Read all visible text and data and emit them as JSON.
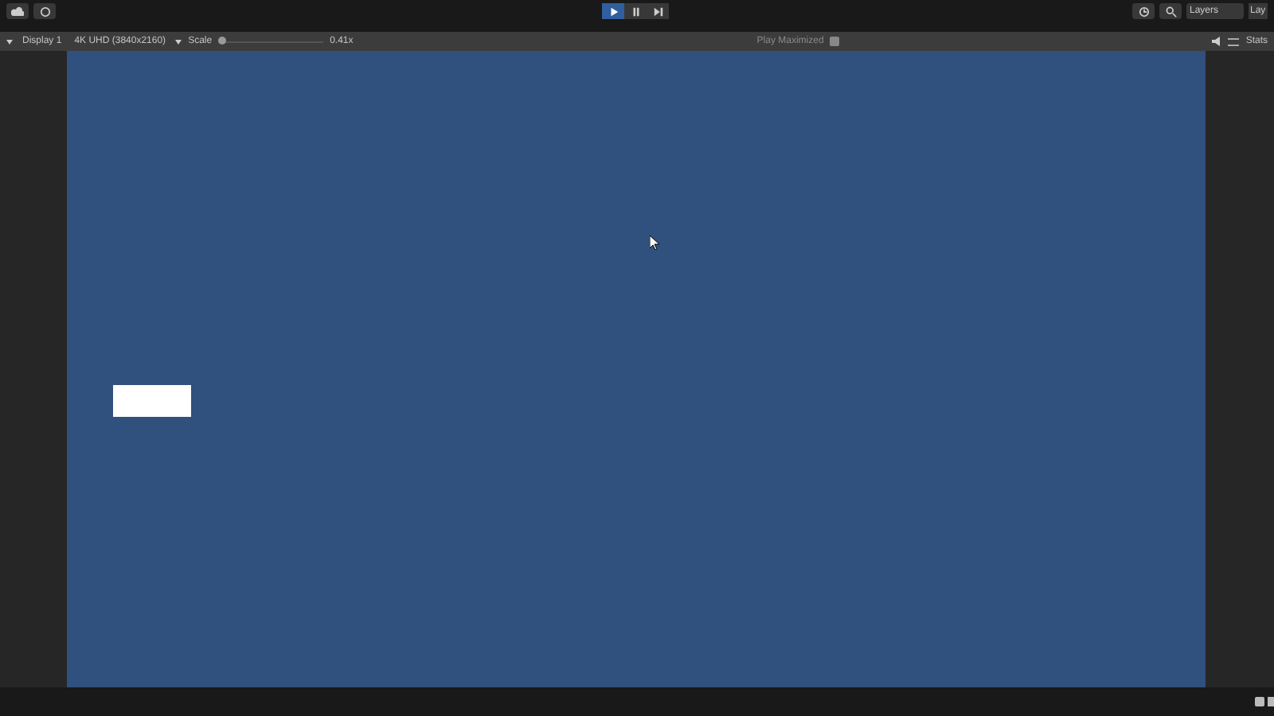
{
  "toolbar": {
    "play_controls": [
      {
        "kind": "play",
        "selected": true
      },
      {
        "kind": "pause",
        "selected": false
      },
      {
        "kind": "step",
        "selected": false
      }
    ],
    "layers": "Layers",
    "layout": "Lay"
  },
  "game_toolbar": {
    "display": "Display 1",
    "resolution": "4K UHD (3840x2160)",
    "scale_label": "Scale",
    "scale": {
      "level": 0.0
    },
    "scale_reading": "0.41x",
    "play_mode": "Play Maximized",
    "stats": "Stats"
  }
}
